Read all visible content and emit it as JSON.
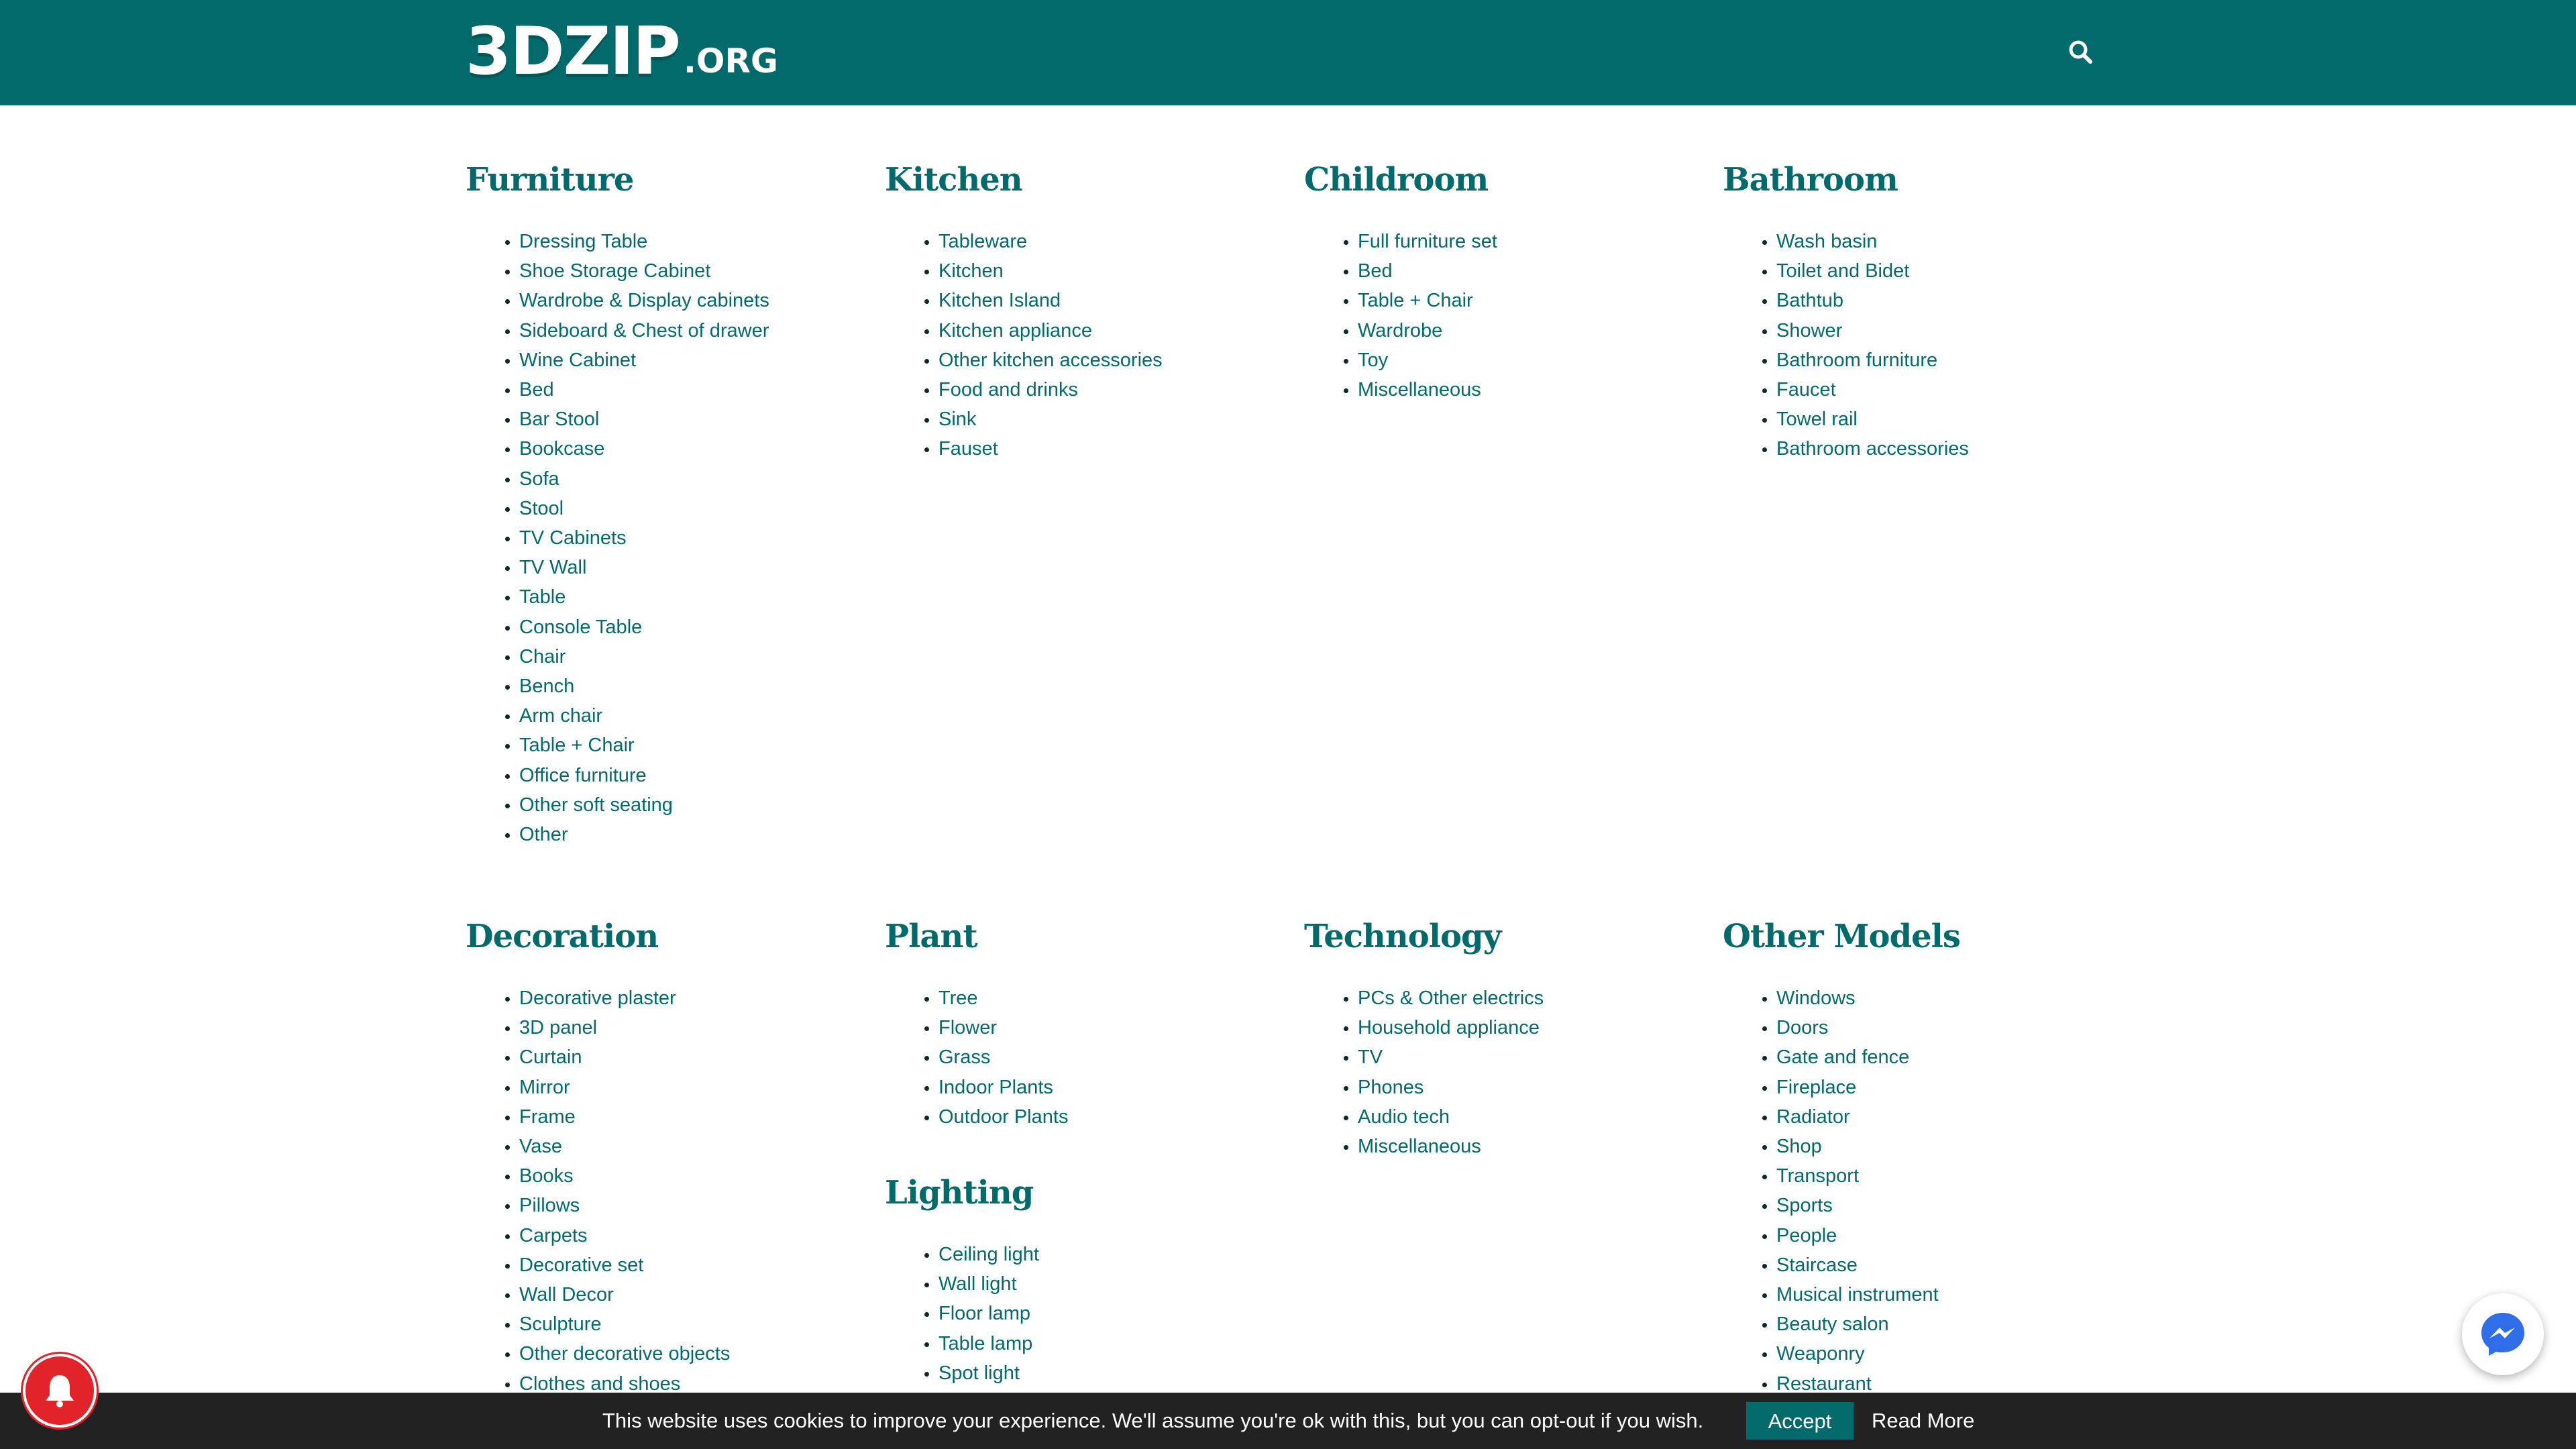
{
  "header": {
    "logo_main": "3DZIP",
    "logo_ext": ".ORG"
  },
  "categories": [
    {
      "title": "Furniture",
      "items": [
        "Dressing Table",
        "Shoe Storage Cabinet",
        "Wardrobe & Display cabinets",
        "Sideboard & Chest of drawer",
        "Wine Cabinet",
        "Bed",
        "Bar Stool",
        "Bookcase",
        "Sofa",
        "Stool",
        "TV Cabinets",
        "TV Wall",
        "Table",
        "Console Table",
        "Chair",
        "Bench",
        "Arm chair",
        "Table + Chair",
        "Office furniture",
        "Other soft seating",
        "Other"
      ]
    },
    {
      "title": "Kitchen",
      "items": [
        "Tableware",
        "Kitchen",
        "Kitchen Island",
        "Kitchen appliance",
        "Other kitchen accessories",
        "Food and drinks",
        "Sink",
        "Fauset"
      ]
    },
    {
      "title": "Childroom",
      "items": [
        "Full furniture set",
        "Bed",
        "Table + Chair",
        "Wardrobe",
        "Toy",
        "Miscellaneous"
      ]
    },
    {
      "title": "Bathroom",
      "items": [
        "Wash basin",
        "Toilet and Bidet",
        "Bathtub",
        "Shower",
        "Bathroom furniture",
        "Faucet",
        "Towel rail",
        "Bathroom accessories"
      ]
    },
    {
      "title": "Decoration",
      "items": [
        "Decorative plaster",
        "3D panel",
        "Curtain",
        "Mirror",
        "Frame",
        "Vase",
        "Books",
        "Pillows",
        "Carpets",
        "Decorative set",
        "Wall Decor",
        "Sculpture",
        "Other decorative objects",
        "Clothes and shoes"
      ]
    },
    {
      "title": "Plant",
      "items": [
        "Tree",
        "Flower",
        "Grass",
        "Indoor Plants",
        "Outdoor Plants"
      ]
    },
    {
      "title": "Technology",
      "items": [
        "PCs & Other electrics",
        "Household appliance",
        "TV",
        "Phones",
        "Audio tech",
        "Miscellaneous"
      ]
    },
    {
      "title": "Other Models",
      "items": [
        "Windows",
        "Doors",
        "Gate and fence",
        "Fireplace",
        "Radiator",
        "Shop",
        "Transport",
        "Sports",
        "People",
        "Staircase",
        "Musical instrument",
        "Beauty salon",
        "Weaponry",
        "Restaurant"
      ]
    },
    {
      "title": "Lighting",
      "items": [
        "Ceiling light",
        "Wall light",
        "Floor lamp",
        "Table lamp",
        "Spot light"
      ]
    }
  ],
  "cookie": {
    "text": "This website uses cookies to improve your experience. We'll assume you're ok with this, but you can opt-out if you wish.",
    "accept": "Accept",
    "read_more": "Read More"
  },
  "icons": {
    "search": "search-icon",
    "bell": "bell-icon",
    "messenger": "messenger-icon"
  },
  "colors": {
    "brand": "#036a6c",
    "cookie_bar": "#222222",
    "bell": "#e2232a",
    "messenger": "#2f6ee8"
  }
}
